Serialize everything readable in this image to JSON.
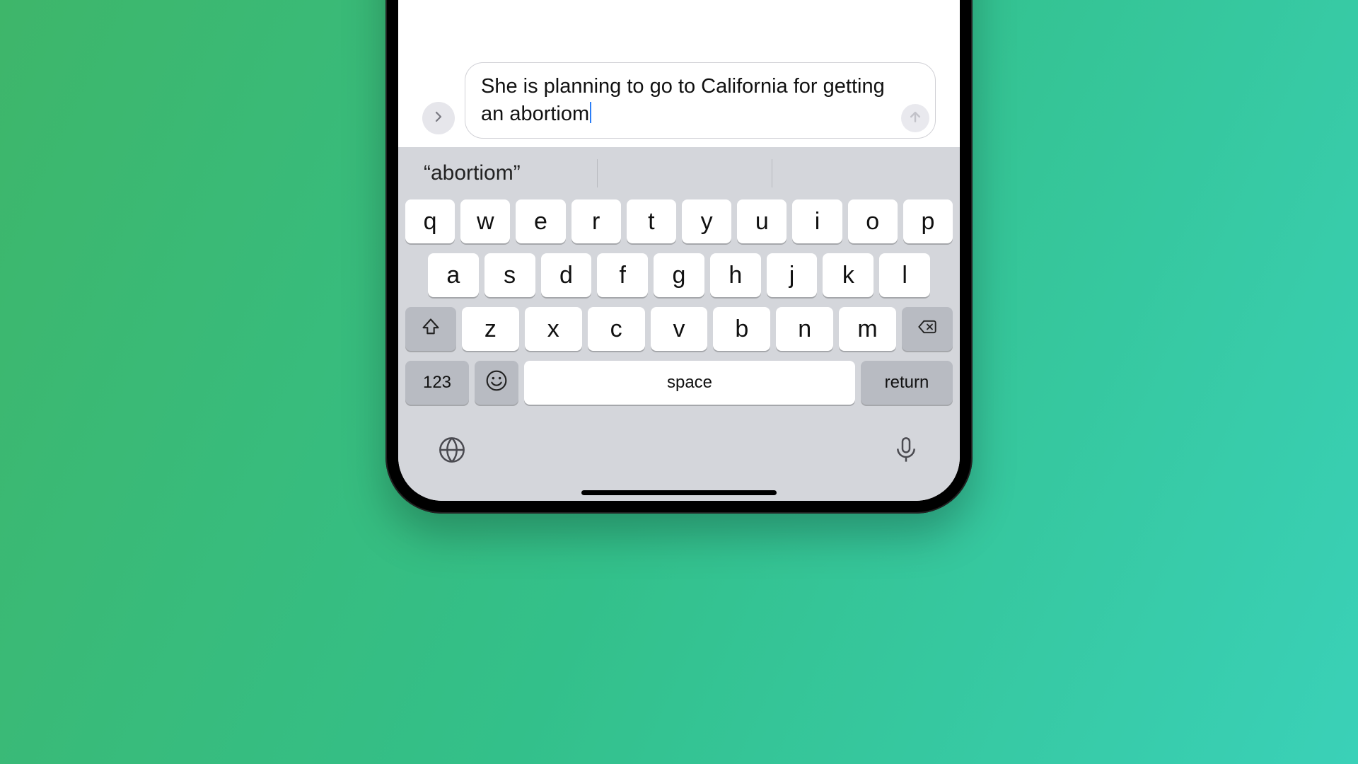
{
  "compose": {
    "text": "She is planning to go to California for getting an abortiom"
  },
  "suggestions": {
    "first": "“abortiom”",
    "second": "",
    "third": ""
  },
  "keyboard": {
    "row1": [
      "q",
      "w",
      "e",
      "r",
      "t",
      "y",
      "u",
      "i",
      "o",
      "p"
    ],
    "row2": [
      "a",
      "s",
      "d",
      "f",
      "g",
      "h",
      "j",
      "k",
      "l"
    ],
    "row3": [
      "z",
      "x",
      "c",
      "v",
      "b",
      "n",
      "m"
    ],
    "numbers_label": "123",
    "space_label": "space",
    "return_label": "return"
  }
}
